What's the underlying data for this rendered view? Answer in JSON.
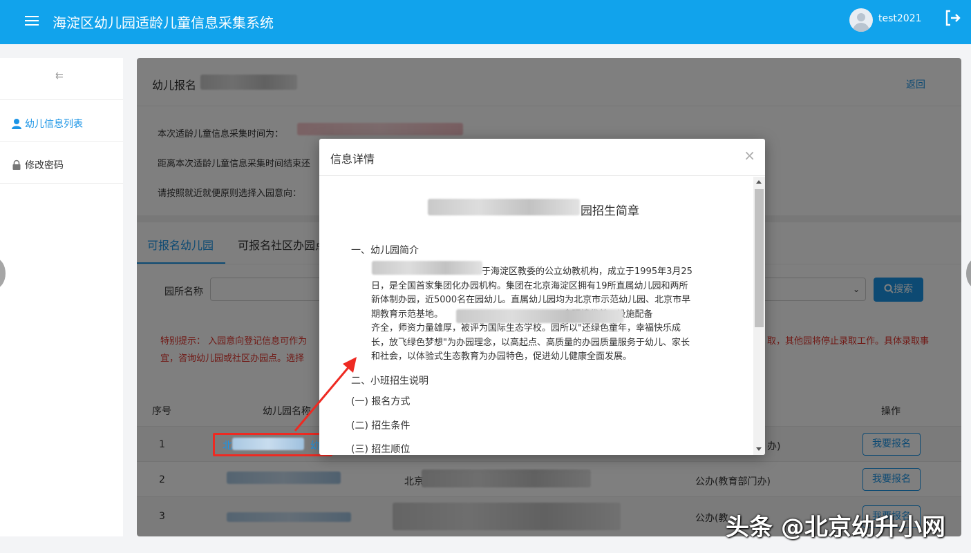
{
  "header": {
    "app_title": "海淀区幼儿园适龄儿童信息采集系统",
    "username": "test2021"
  },
  "sidebar": {
    "items": [
      {
        "label": "幼儿信息列表",
        "icon": "user-icon",
        "active": true
      },
      {
        "label": "修改密码",
        "icon": "lock-icon",
        "active": false
      }
    ]
  },
  "main": {
    "title_prefix": "幼儿报名",
    "back_label": "返回",
    "info_lines": [
      "本次适龄儿童信息采集时间为：",
      "距离本次适龄儿童信息采集时间结束还",
      "请按照就近就便原则选择入园意向："
    ],
    "tabs": [
      {
        "label": "可报名幼儿园",
        "active": true
      },
      {
        "label": "可报名社区办园点",
        "active": false
      }
    ],
    "filter": {
      "label": "园所名称",
      "search_label": "搜索"
    },
    "notice": {
      "left_1": "特别提示：  入园意向登记信息可作为",
      "left_2": "宜，咨询幼儿园或社区办园点。选择",
      "right_1": "取，其他园将停止录取工作。具体录取事"
    },
    "table": {
      "headers": [
        "序号",
        "幼儿园名称",
        "操作"
      ],
      "rows": [
        {
          "index": "1",
          "name_start": "北",
          "name_end": "幼",
          "type": "办)",
          "action": "我要报名"
        },
        {
          "index": "2",
          "address_start": "北京市",
          "type": "公办(教育部门办)",
          "action": "我要报名"
        },
        {
          "index": "3",
          "type": "公办(教",
          "action": "我要报名"
        }
      ]
    }
  },
  "modal": {
    "title": "信息详情",
    "close_label": "×",
    "doc_title_suffix": "园招生简章",
    "section1_heading": "一、幼儿园简介",
    "section1_lines": [
      "于海淀区教委的公立幼教机构，成立于1995年3月25",
      "日，是全国首家集团化办园机构。集团在北京海淀区拥有19所直属幼儿园和两所",
      "新体制办园，近5000名在园幼儿。直属幼儿园均为北京市示范幼儿园、北京市早",
      "期教育示范基地。                                          舍环境优美，设施配备",
      "齐全，师资力量雄厚，被评为国际生态学校。园所以\"还绿色童年，幸福快乐成",
      "长，放飞绿色梦想\"为办园理念，以高起点、高质量的办园质量服务于幼儿、家长",
      "和社会，以体验式生态教育为办园特色，促进幼儿健康全面发展。"
    ],
    "section2_heading": "二、小班招生说明",
    "subsections": [
      "(一) 报名方式",
      "(二) 招生条件",
      "(三) 招生顺位"
    ]
  },
  "watermark": "头条 @北京幼升小网",
  "colors": {
    "primary": "#11a3ec",
    "link": "#1a94e6",
    "danger": "#e0322b",
    "annotation": "#ee2a22"
  }
}
